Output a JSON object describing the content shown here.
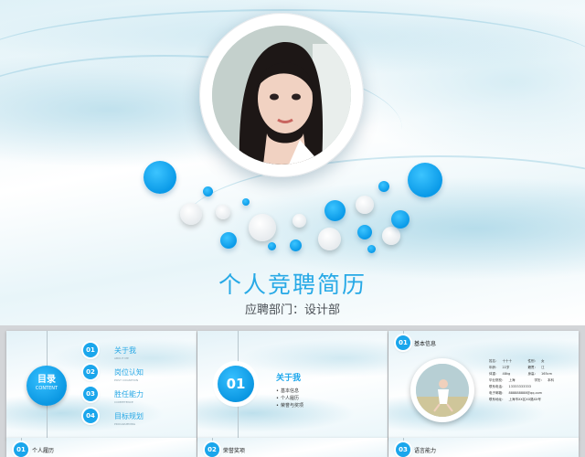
{
  "hero": {
    "title": "个人竞聘简历",
    "subtitle": "应聘部门：设计部"
  },
  "thumb1": {
    "badge_cn": "目录",
    "badge_en": "CONTENT",
    "items": [
      {
        "num": "01",
        "cn": "关于我",
        "en": "ABOUT ME"
      },
      {
        "num": "02",
        "cn": "岗位认知",
        "en": "POST COGNITION"
      },
      {
        "num": "03",
        "cn": "胜任能力",
        "en": "COMPETENCE"
      },
      {
        "num": "04",
        "cn": "目标规划",
        "en": "PROGRAMMING"
      }
    ]
  },
  "thumb2": {
    "num": "01",
    "title": "关于我",
    "bullets": [
      "基本信息",
      "个人履历",
      "荣誉与奖项"
    ]
  },
  "thumb3": {
    "num": "01",
    "label": "基本信息",
    "info": [
      [
        "姓名：",
        "十十十",
        "性别：",
        "女"
      ],
      [
        "年龄：",
        "22岁",
        "籍贯：",
        "江"
      ],
      [
        "体重：",
        "48kg",
        "身高：",
        "165cm"
      ],
      [
        "毕业院校：",
        "上海",
        "学历：",
        "本科"
      ],
      [
        "联系电话：",
        "13333333333",
        "",
        ""
      ],
      [
        "电子邮箱：",
        "888888888@qq.com",
        "",
        ""
      ],
      [
        "联系地址：",
        "上海市XX区XX路XX号",
        "",
        ""
      ]
    ]
  },
  "strips": [
    {
      "num": "01",
      "label": "个人履历"
    },
    {
      "num": "02",
      "label": "荣誉奖项"
    },
    {
      "num": "03",
      "label": "语言能力"
    }
  ],
  "colors": {
    "accent": "#1aa6ec",
    "title": "#27a9e6"
  }
}
